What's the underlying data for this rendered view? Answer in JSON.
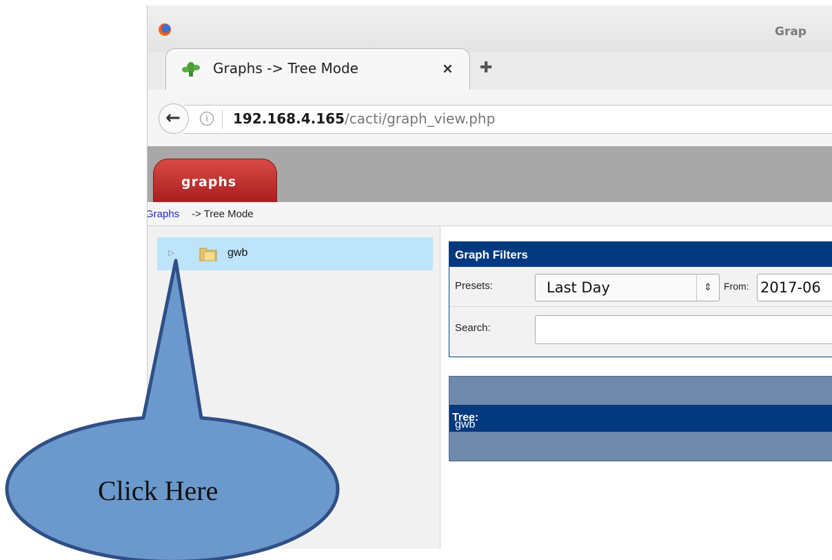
{
  "window": {
    "title": "Grap"
  },
  "tab": {
    "label": "Graphs -> Tree Mode",
    "close_glyph": "×",
    "new_tab_glyph": "✚"
  },
  "nav": {
    "back_glyph": "←",
    "info_glyph": "i",
    "url_host": "192.168.4.165",
    "url_path": "/cacti/graph_view.php"
  },
  "app": {
    "tab_label": "graphs",
    "breadcrumb": {
      "link": "Graphs",
      "rest": "-> Tree Mode"
    }
  },
  "tree": {
    "items": [
      {
        "label": "gwb",
        "icon": "folder-icon"
      }
    ]
  },
  "filters": {
    "title": "Graph Filters",
    "presets_label": "Presets:",
    "presets_value": "Last Day",
    "from_label": "From:",
    "from_value": "2017-06",
    "search_label": "Search:",
    "search_value": ""
  },
  "tree_panel": {
    "prefix": "Tree:",
    "name": "gwb"
  },
  "annotation": {
    "text": "Click Here"
  },
  "colors": {
    "header_blue": "#02397f",
    "tree_selected": "#bde4fb",
    "callout_fill": "#6c99cc",
    "callout_stroke": "#2f4f86"
  }
}
